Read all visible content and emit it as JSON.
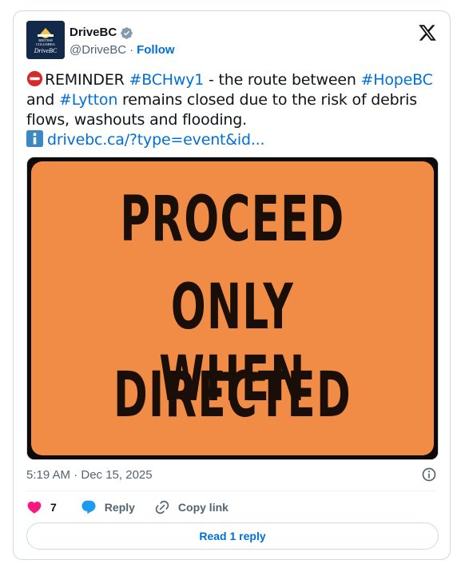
{
  "author": {
    "display_name": "DriveBC",
    "handle": "@DriveBC",
    "separator": "·",
    "follow_label": "Follow",
    "verified": true,
    "avatar": {
      "line1": "BRITISH",
      "line2": "COLUMBIA",
      "brand": "DriveBC"
    }
  },
  "tweet": {
    "segments": {
      "s1": "REMINDER ",
      "tag1": "#BCHwy1",
      "s2": " - the route between ",
      "tag2": "#HopeBC",
      "s3": " and ",
      "tag3": "#Lytton",
      "s4": " remains closed due to the risk of debris flows, washouts and flooding.",
      "link": "drivebc.ca/?type=event&id..."
    },
    "icons": {
      "leading": "no-entry-icon",
      "link_prefix": "information-icon"
    }
  },
  "media": {
    "sign_lines": [
      "PROCEED",
      "ONLY WHEN",
      "DIRECTED"
    ],
    "sign_color": "#f08c45",
    "text_color": "#1a0e08"
  },
  "timestamp": "5:19 AM · Dec 15, 2025",
  "actions": {
    "like_count": "7",
    "reply_label": "Reply",
    "copy_link_label": "Copy link"
  },
  "read_replies_label": "Read 1 reply",
  "colors": {
    "accent": "#006fd6",
    "like": "#f91880",
    "secondary_text": "#536471",
    "verified": "#829aab"
  }
}
